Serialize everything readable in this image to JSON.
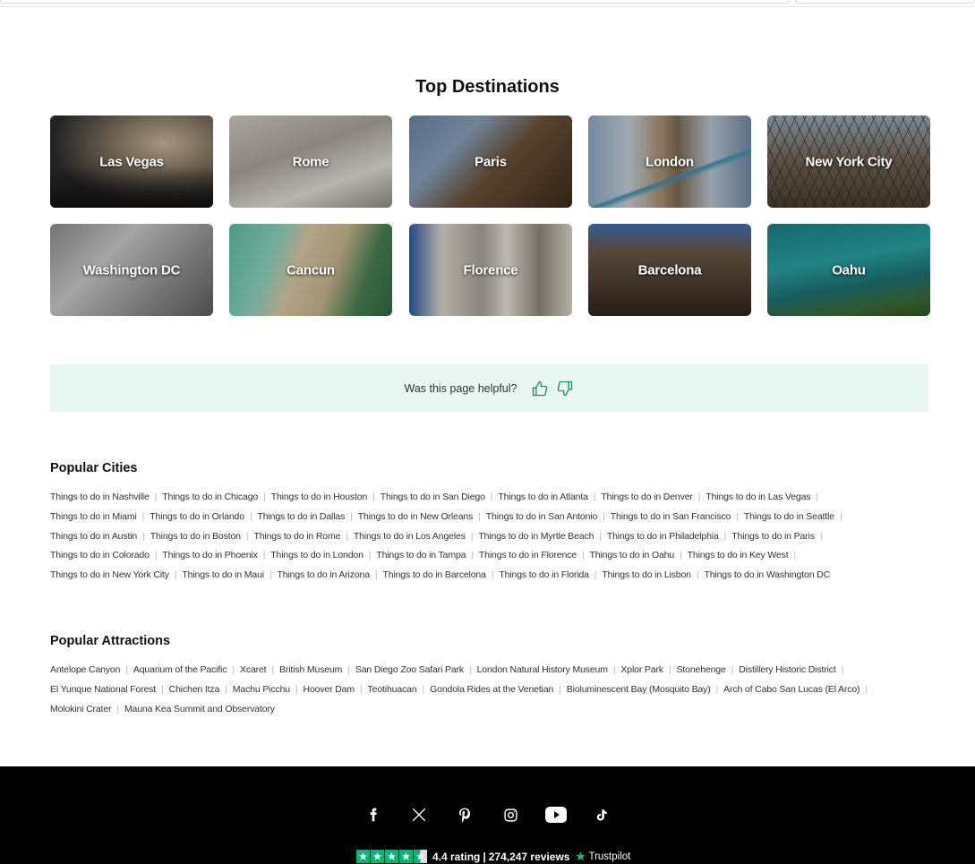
{
  "top_destinations": {
    "title": "Top Destinations",
    "cards": [
      {
        "name": "Las Vegas"
      },
      {
        "name": "Rome"
      },
      {
        "name": "Paris"
      },
      {
        "name": "London"
      },
      {
        "name": "New York City"
      },
      {
        "name": "Washington DC"
      },
      {
        "name": "Cancun"
      },
      {
        "name": "Florence"
      },
      {
        "name": "Barcelona"
      },
      {
        "name": "Oahu"
      }
    ]
  },
  "feedback": {
    "question": "Was this page helpful?",
    "thumbs_up_icon": "thumbs-up-icon",
    "thumbs_down_icon": "thumbs-down-icon"
  },
  "popular_cities": {
    "title": "Popular Cities",
    "lines": [
      [
        "Things to do in Nashville",
        "Things to do in Chicago",
        "Things to do in Houston",
        "Things to do in San Diego",
        "Things to do in Atlanta",
        "Things to do in Denver",
        "Things to do in Las Vegas"
      ],
      [
        "Things to do in Miami",
        "Things to do in Orlando",
        "Things to do in Dallas",
        "Things to do in New Orleans",
        "Things to do in San Antonio",
        "Things to do in San Francisco",
        "Things to do in Seattle"
      ],
      [
        "Things to do in Austin",
        "Things to do in Boston",
        "Things to do in Rome",
        "Things to do in Los Angeles",
        "Things to do in Myrtle Beach",
        "Things to do in Philadelphia",
        "Things to do in Paris"
      ],
      [
        "Things to do in Colorado",
        "Things to do in Phoenix",
        "Things to do in London",
        "Things to do in Tampa",
        "Things to do in Florence",
        "Things to do in Oahu",
        "Things to do in Key West"
      ],
      [
        "Things to do in New York City",
        "Things to do in Maui",
        "Things to do in Arizona",
        "Things to do in Barcelona",
        "Things to do in Florida",
        "Things to do in Lisbon",
        "Things to do in Washington DC"
      ]
    ]
  },
  "popular_attractions": {
    "title": "Popular Attractions",
    "lines": [
      [
        "Antelope Canyon",
        "Aquarium of the Pacific",
        "Xcaret",
        "British Museum",
        "San Diego Zoo Safari Park",
        "London Natural History Museum",
        "Xplor Park",
        "Stonehenge",
        "Distillery Historic District"
      ],
      [
        "El Yunque National Forest",
        "Chichen Itza",
        "Machu Picchu",
        "Hoover Dam",
        "Teotihuacan",
        "Gondola Rides at the Venetian",
        "Bioluminescent Bay (Mosquito Bay)",
        "Arch of Cabo San Lucas (El Arco)"
      ],
      [
        "Molokini Crater",
        "Mauna Kea Summit and Observatory"
      ]
    ]
  },
  "footer": {
    "social": [
      "facebook-icon",
      "x-icon",
      "pinterest-icon",
      "instagram-icon",
      "youtube-icon",
      "tiktok-icon"
    ],
    "rating": "4.4 rating",
    "reviews": "274,247 reviews",
    "trustpilot": "Trustpilot",
    "colors": {
      "trustpilot_green": "#00b67a",
      "footer_bg": "#000000",
      "feedback_bg": "#e8f7f2"
    }
  }
}
